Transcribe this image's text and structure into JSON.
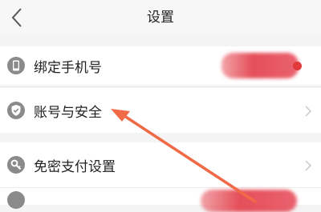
{
  "header": {
    "title": "设置"
  },
  "rows": [
    {
      "label": "绑定手机号"
    },
    {
      "label": "账号与安全"
    },
    {
      "label": "免密支付设置"
    },
    {
      "label": ""
    }
  ],
  "icons": {
    "back": "back-arrow-icon",
    "phone": "phone-icon",
    "security": "shield-check-icon",
    "payment": "key-icon",
    "chevron": "chevron-right-icon"
  },
  "colors": {
    "accent": "#f06a48",
    "icon_gray": "#888888",
    "redacted": "#e34a55",
    "badge": "#e23a3a"
  }
}
